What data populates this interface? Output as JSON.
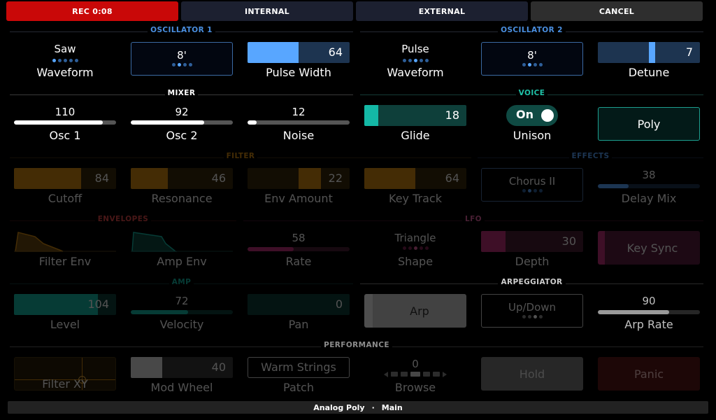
{
  "topbar": {
    "rec": "REC 0:08",
    "internal": "INTERNAL",
    "external": "EXTERNAL",
    "cancel": "CANCEL"
  },
  "sections": {
    "osc1": "OSCILLATOR 1",
    "osc2": "OSCILLATOR 2",
    "mixer": "MIXER",
    "voice": "VOICE",
    "filter": "FILTER",
    "effects": "EFFECTS",
    "envelopes": "ENVELOPES",
    "lfo": "LFO",
    "amp": "AMP",
    "arpeggiator": "ARPEGGIATOR",
    "performance": "PERFORMANCE"
  },
  "osc1": {
    "waveform": {
      "value": "Saw",
      "label": "Waveform"
    },
    "octave": {
      "value": "8'"
    },
    "pulse_width": {
      "value": "64",
      "label": "Pulse Width",
      "level": 0.5
    }
  },
  "osc2": {
    "waveform": {
      "value": "Pulse",
      "label": "Waveform"
    },
    "octave": {
      "value": "8'"
    },
    "detune": {
      "value": "7",
      "label": "Detune",
      "level": 0.55
    }
  },
  "mixer": {
    "osc1": {
      "value": "110",
      "label": "Osc 1",
      "level": 0.87
    },
    "osc2": {
      "value": "92",
      "label": "Osc 2",
      "level": 0.72
    },
    "noise": {
      "value": "12",
      "label": "Noise",
      "level": 0.09
    }
  },
  "voice": {
    "glide": {
      "value": "18",
      "label": "Glide",
      "level": 0.14
    },
    "unison": {
      "value": "On",
      "label": "Unison"
    },
    "poly": {
      "label": "Poly"
    }
  },
  "filter": {
    "cutoff": {
      "value": "84",
      "label": "Cutoff",
      "level": 0.66
    },
    "resonance": {
      "value": "46",
      "label": "Resonance",
      "level": 0.36
    },
    "env_amount": {
      "value": "22",
      "label": "Env Amount",
      "level": 0.22
    }
  },
  "effects": {
    "key_track": {
      "value": "64",
      "label": "Key Track",
      "level": 0.5
    },
    "chorus": {
      "value": "Chorus II"
    },
    "delay_mix": {
      "value": "38",
      "label": "Delay Mix",
      "level": 0.3
    }
  },
  "envelopes": {
    "filter_env": {
      "label": "Filter Env"
    },
    "amp_env": {
      "label": "Amp Env"
    },
    "rate": {
      "value": "58",
      "label": "Rate",
      "level": 0.45
    }
  },
  "lfo": {
    "shape": {
      "value": "Triangle",
      "label": "Shape"
    },
    "depth": {
      "value": "30",
      "label": "Depth",
      "level": 0.24
    },
    "key_sync": {
      "label": "Key Sync"
    }
  },
  "amp": {
    "level": {
      "value": "104",
      "label": "Level",
      "level": 0.82
    },
    "velocity": {
      "value": "72",
      "label": "Velocity",
      "level": 0.56
    },
    "pan": {
      "value": "0",
      "label": "Pan",
      "level": 0
    }
  },
  "arpeggiator": {
    "arp": {
      "label": "Arp"
    },
    "mode": {
      "value": "Up/Down"
    },
    "arp_rate": {
      "value": "90",
      "label": "Arp Rate",
      "level": 0.7
    }
  },
  "performance": {
    "filter_xy": {
      "label": "Filter XY"
    },
    "mod_wheel": {
      "value": "40",
      "label": "Mod Wheel",
      "level": 0.31
    },
    "patch": {
      "value": "Warm Strings",
      "label": "Patch"
    },
    "browse": {
      "value": "0",
      "label": "Browse"
    },
    "hold": {
      "label": "Hold"
    },
    "panic": {
      "label": "Panic"
    }
  },
  "footer": {
    "preset": "Analog Poly",
    "separator": "·",
    "page": "Main"
  },
  "colors": {
    "blue": "#58a6ff",
    "teal": "#14b8a6",
    "amber": "#d38a10",
    "pink": "#c0307a",
    "red": "#c90808"
  }
}
